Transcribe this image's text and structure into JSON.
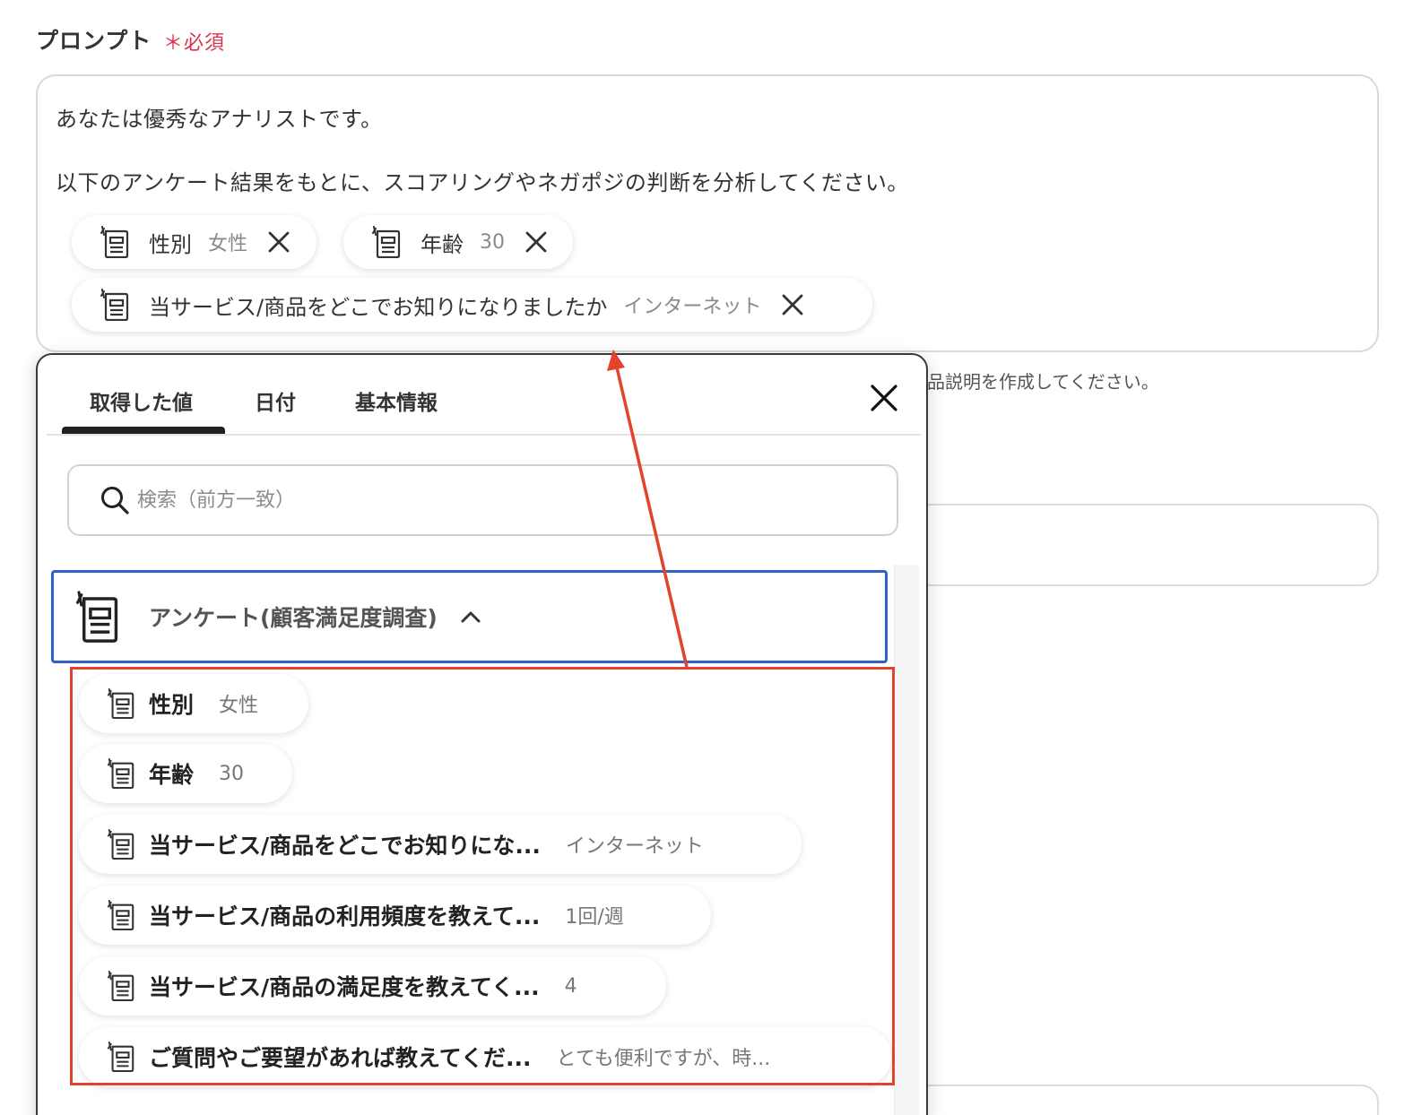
{
  "field": {
    "label": "プロンプト",
    "required": "＊必須"
  },
  "prompt": {
    "line1": "あなたは優秀なアナリストです。",
    "line2": "以下のアンケート結果をもとに、スコアリングやネガポジの判断を分析してください。",
    "chips": [
      {
        "name": "性別",
        "value": "女性"
      },
      {
        "name": "年齢",
        "value": "30"
      },
      {
        "name": "当サービス/商品をどこでお知りになりましたか",
        "value": "インターネット"
      }
    ]
  },
  "background": {
    "hint": "品説明を作成してください。"
  },
  "popup": {
    "tabs": [
      "取得した値",
      "日付",
      "基本情報"
    ],
    "search_placeholder": "検索（前方一致）",
    "group_label": "アンケート(顧客満足度調査)",
    "items": [
      {
        "name": "性別",
        "value": "女性"
      },
      {
        "name": "年齢",
        "value": "30"
      },
      {
        "name": "当サービス/商品をどこでお知りにな...",
        "value": "インターネット"
      },
      {
        "name": "当サービス/商品の利用頻度を教えて...",
        "value": "1回/週"
      },
      {
        "name": "当サービス/商品の満足度を教えてく...",
        "value": "4"
      },
      {
        "name": "ご質問やご要望があれば教えてくだ...",
        "value": "とても便利ですが、時..."
      }
    ]
  },
  "colors": {
    "required": "#d8334f",
    "group_border": "#2f62c4",
    "annotation": "#e3432a"
  },
  "icons": {
    "chip": "form-doc-icon",
    "remove": "close-icon",
    "search": "search-icon",
    "collapse": "chevron-up-icon"
  }
}
